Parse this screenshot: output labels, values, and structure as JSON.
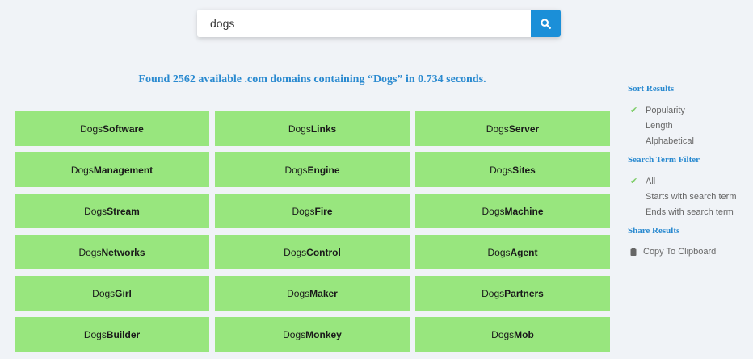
{
  "search": {
    "value": "dogs"
  },
  "summary": "Found 2562 available .com domains containing “Dogs” in 0.734 seconds.",
  "prefix": "Dogs",
  "domains": [
    "Software",
    "Links",
    "Server",
    "Management",
    "Engine",
    "Sites",
    "Stream",
    "Fire",
    "Machine",
    "Networks",
    "Control",
    "Agent",
    "Girl",
    "Maker",
    "Partners",
    "Builder",
    "Monkey",
    "Mob"
  ],
  "sidebar": {
    "sort": {
      "heading": "Sort Results",
      "options": [
        "Popularity",
        "Length",
        "Alphabetical"
      ],
      "selected": 0
    },
    "filter": {
      "heading": "Search Term Filter",
      "options": [
        "All",
        "Starts with search term",
        "Ends with search term"
      ],
      "selected": 0
    },
    "share": {
      "heading": "Share Results",
      "copy_label": "Copy To Clipboard"
    }
  },
  "colors": {
    "accent": "#2a8ad0",
    "search_button": "#1b8fd8",
    "tile": "#98e67e",
    "check": "#7fce6a"
  },
  "icons": {
    "search": "search-icon",
    "check": "check-icon",
    "clipboard": "clipboard-icon"
  }
}
